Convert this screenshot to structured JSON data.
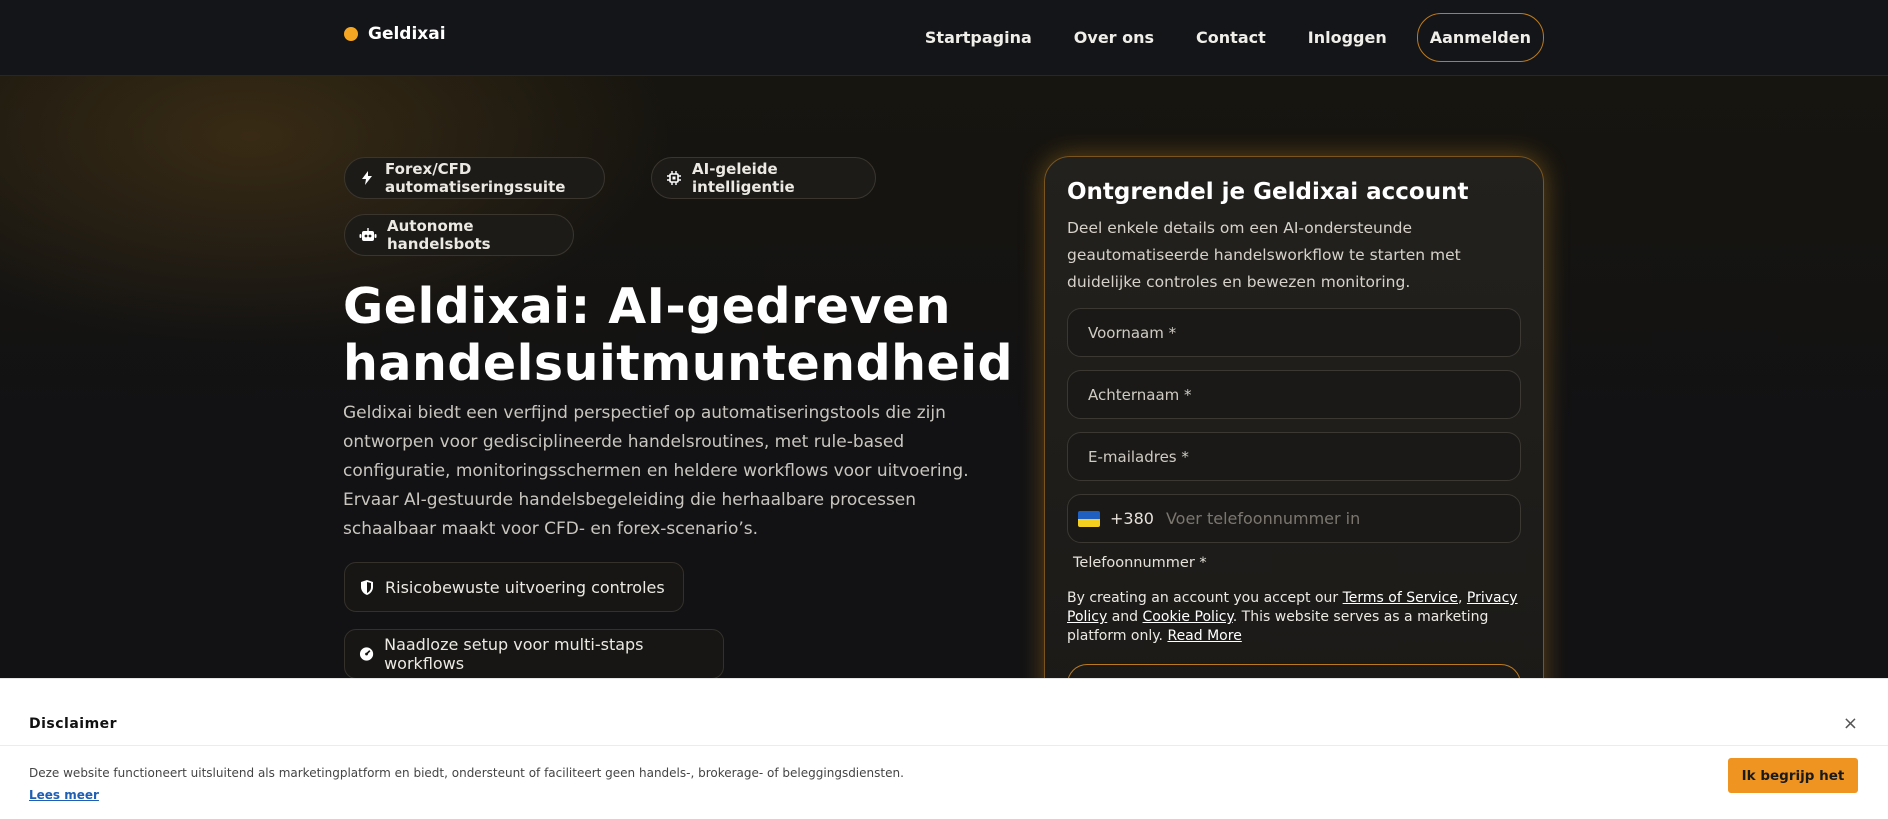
{
  "brand": {
    "name": "Geldixai",
    "accent_color": "#f5a623"
  },
  "nav": {
    "items": [
      "Startpagina",
      "Over ons",
      "Contact",
      "Inloggen"
    ],
    "signup_label": "Aanmelden"
  },
  "hero": {
    "tags": [
      {
        "label": "Forex/CFD automatiseringssuite",
        "icon": "lightning-icon"
      },
      {
        "label": "AI-geleide intelligentie",
        "icon": "chip-icon"
      },
      {
        "label": "Autonome handelsbots",
        "icon": "robot-icon"
      }
    ],
    "title": "Geldixai: AI-gedreven handelsuitmuntendheid",
    "description": "Geldixai biedt een verfijnd perspectief op automatiseringstools die zijn ontworpen voor gedisciplineerde handelsroutines, met rule-based configuratie, monitoringsschermen en heldere workflows voor uitvoering. Ervaar AI-gestuurde handelsbegeleiding die herhaalbare processen schaalbaar maakt voor CFD- en forex-scenario’s.",
    "features": [
      {
        "label": "Risicobewuste uitvoering controles",
        "icon": "shield-icon"
      },
      {
        "label": "Naadloze setup voor multi-staps workflows",
        "icon": "gauge-icon"
      }
    ]
  },
  "form": {
    "title": "Ontgrendel je Geldixai account",
    "subtitle": "Deel enkele details om een AI-ondersteunde geautomatiseerde handelsworkflow te starten met duidelijke controles en bewezen monitoring.",
    "first_name_placeholder": "Voornaam *",
    "last_name_placeholder": "Achternaam *",
    "email_placeholder": "E-mailadres *",
    "phone": {
      "dial_code": "+380",
      "placeholder": "Voer telefoonnummer in",
      "label": "Telefoonnummer *",
      "flag_colors": [
        "#1f5fbf",
        "#f5cf1f"
      ]
    },
    "terms": {
      "prefix": "By creating an account you accept our ",
      "tos": "Terms of Service",
      "sep1": ", ",
      "privacy": "Privacy Policy",
      "and": " and ",
      "cookie": "Cookie Policy",
      "suffix": ". This website serves as a marketing platform only. ",
      "read_more": "Read More"
    }
  },
  "disclaimer": {
    "title": "Disclaimer",
    "close_glyph": "×",
    "text": "Deze website functioneert uitsluitend als marketingplatform en biedt, ondersteunt of faciliteert geen handels-, brokerage- of beleggingsdiensten.",
    "more_label": "Lees meer",
    "accept_label": "Ik begrijp het",
    "accept_color": "#ef9421"
  }
}
